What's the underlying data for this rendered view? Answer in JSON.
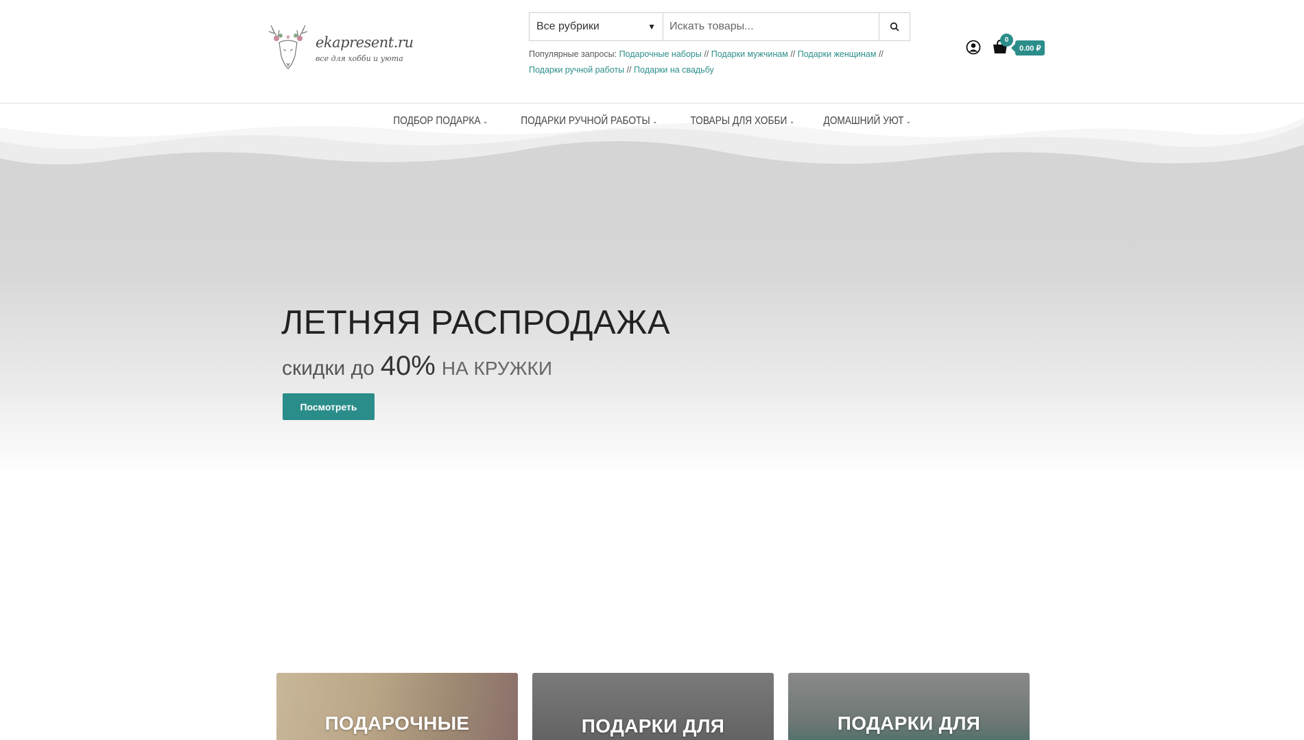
{
  "brand": {
    "name": "ekapresent.ru",
    "tagline": "все для хобби и уюта"
  },
  "search": {
    "category_selected": "Все рубрики",
    "placeholder": "Искать товары...",
    "popular_label": "Популярные запросы:",
    "popular_items": [
      "Подарочные наборы",
      "Подарки мужчинам",
      "Подарки женщинам",
      "Подарки ручной работы",
      "Подарки на свадьбу"
    ],
    "separator": "//"
  },
  "cart": {
    "count": "0",
    "total": "0.00 ₽"
  },
  "nav": {
    "items": [
      {
        "label": "ПОДБОР ПОДАРКА"
      },
      {
        "label": "ПОДАРКИ РУЧНОЙ РАБОТЫ"
      },
      {
        "label": "ТОВАРЫ ДЛЯ ХОББИ"
      },
      {
        "label": "ДОМАШНИЙ УЮТ"
      }
    ]
  },
  "hero": {
    "title": "ЛЕТНЯЯ РАСПРОДАЖА",
    "sub_prefix": "скидки до",
    "sub_value": "40%",
    "sub_suffix": "НА КРУЖКИ",
    "button_label": "Посмотреть"
  },
  "categories": [
    {
      "label": "ПОДАРОЧНЫЕ"
    },
    {
      "label": "ПОДАРКИ ДЛЯ"
    },
    {
      "label": "ПОДАРКИ ДЛЯ"
    }
  ],
  "colors": {
    "accent": "#2b8d8a"
  }
}
